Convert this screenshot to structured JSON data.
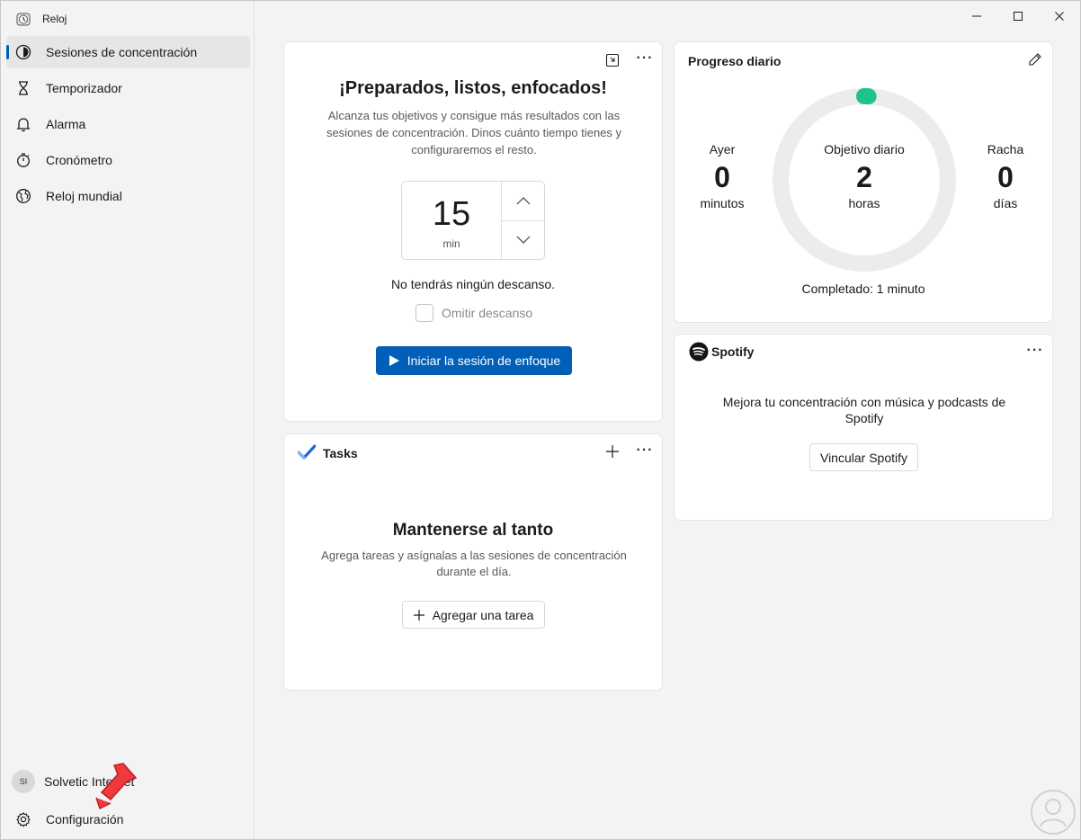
{
  "app": {
    "title": "Reloj"
  },
  "sidebar": {
    "items": [
      {
        "label": "Sesiones de concentración",
        "icon": "focus-icon"
      },
      {
        "label": "Temporizador",
        "icon": "hourglass-icon"
      },
      {
        "label": "Alarma",
        "icon": "bell-icon"
      },
      {
        "label": "Cronómetro",
        "icon": "stopwatch-icon"
      },
      {
        "label": "Reloj mundial",
        "icon": "globe-icon"
      }
    ],
    "account": {
      "initials": "SI",
      "name": "Solvetic Internet"
    },
    "settings_label": "Configuración"
  },
  "focus": {
    "title": "¡Preparados, listos, enfocados!",
    "description": "Alcanza tus objetivos y consigue más resultados con las sesiones de concentración. Dinos cuánto tiempo tienes y configuraremos el resto.",
    "minutes": "15",
    "unit": "min",
    "break_text": "No tendrás ningún descanso.",
    "skip_break_label": "Omitir descanso",
    "start_label": "Iniciar la sesión de enfoque"
  },
  "tasks": {
    "title": "Tasks",
    "heading": "Mantenerse al tanto",
    "description": "Agrega tareas y asígnalas a las sesiones de concentración durante el día.",
    "add_label": "Agregar una tarea"
  },
  "progress": {
    "title": "Progreso diario",
    "yesterday": {
      "label": "Ayer",
      "value": "0",
      "unit": "minutos"
    },
    "goal": {
      "label": "Objetivo diario",
      "value": "2",
      "unit": "horas"
    },
    "streak": {
      "label": "Racha",
      "value": "0",
      "unit": "días"
    },
    "completed": "Completado: 1 minuto",
    "progress_fraction": 0.008
  },
  "spotify": {
    "brand": "Spotify",
    "description": "Mejora tu concentración con música y podcasts de Spotify",
    "link_label": "Vincular Spotify"
  },
  "colors": {
    "accent": "#005fb8",
    "progress": "#1dc28e",
    "ring_track": "#ececec"
  }
}
